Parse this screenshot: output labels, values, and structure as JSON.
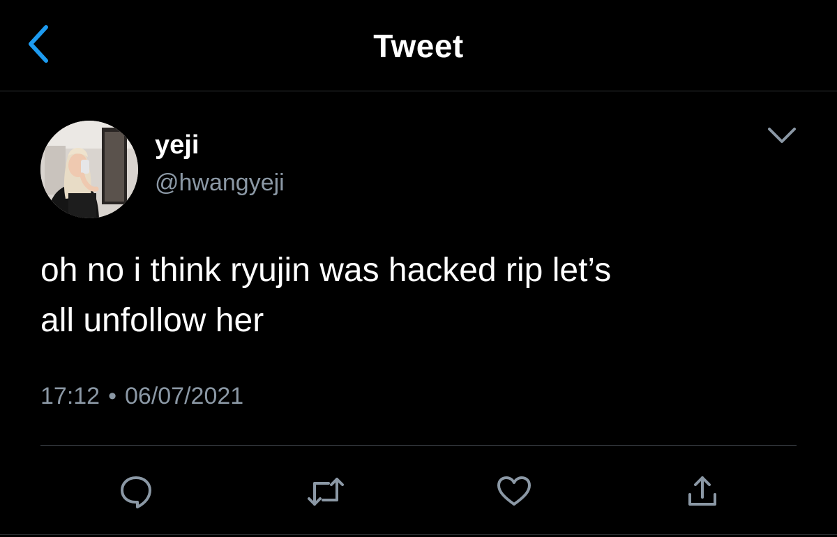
{
  "header": {
    "title": "Tweet",
    "back_icon": "chevron-left-icon",
    "back_color": "#1d9bf0"
  },
  "tweet": {
    "author": {
      "name": "yeji",
      "handle": "@hwangyeji",
      "avatar_icon": "profile-photo"
    },
    "text_lines": [
      "oh no i think ryujin was hacked rip let’s",
      "all unfollow her"
    ],
    "time": "17:12",
    "separator": "•",
    "date": "06/07/2021",
    "more_icon": "chevron-down-icon"
  },
  "actions": [
    {
      "icon": "reply-icon"
    },
    {
      "icon": "retweet-icon"
    },
    {
      "icon": "like-icon"
    },
    {
      "icon": "share-icon"
    }
  ],
  "colors": {
    "background": "#000000",
    "text": "#ffffff",
    "secondary_text": "#8b98a5",
    "accent": "#1d9bf0",
    "icon_gray": "#8b98a5"
  }
}
